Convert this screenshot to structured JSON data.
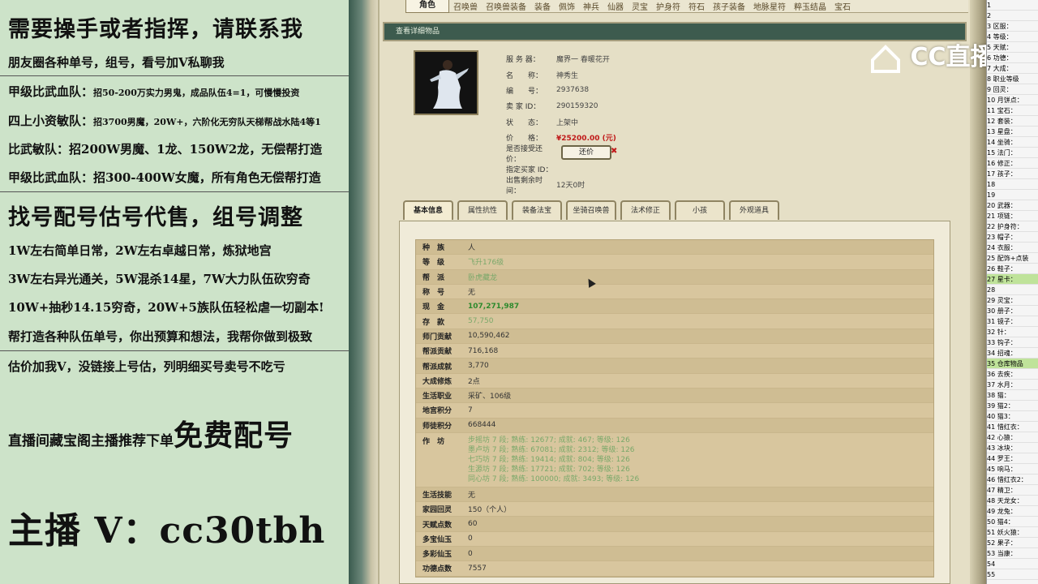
{
  "ad": {
    "l1": "需要操手或者指挥，请联系我",
    "l2": "朋友圈各种单号，组号，看号加V私聊我",
    "l3a": "甲级比武血队：",
    "l3b": "招50-200万实力男鬼，成品队伍4=1，可慢慢投资",
    "l4a": "四上小资敏队：",
    "l4b": "招3700男魔，20W+，六阶化无穷队天梯帮战水陆4等1",
    "l5": "比武敏队：招200W男魔、1龙、150W2龙，无偿帮打造",
    "l6": "甲级比武血队：招300-400W女魔，所有角色无偿帮打造",
    "l7": "找号配号估号代售，组号调整",
    "l8": "1W左右简单日常，2W左右卓越日常，炼狱地宫",
    "l9": "3W左右异光通关，5W混杀14星，7W大力队伍砍穷奇",
    "l10": "10W+抽秒14.15穷奇，20W+5族队伍轻松虐一切副本!",
    "l11": "帮打造各种队伍单号，你出预算和想法，我帮你做到极致",
    "l12": "估价加我V，没链接上号估，列明细买号卖号不吃亏",
    "l13a": "直播间藏宝阁主播推荐下单",
    "l13b": "免费配号",
    "l14": "主播 V：cc30tbh"
  },
  "nav": [
    "角色",
    "召唤兽",
    "召唤兽装备",
    "装备",
    "佩饰",
    "神兵",
    "仙器",
    "灵宝",
    "护身符",
    "符石",
    "孩子装备",
    "地脉星符",
    "粹玉结晶",
    "宝石"
  ],
  "title": "查看详细物品",
  "info": {
    "server_k": "服 务 器：",
    "server_v": "魔界一 春暖花开",
    "name_k": "名　　称：",
    "name_v": "神秀生",
    "id_k": "编　　号：",
    "id_v": "2937638",
    "seller_k": "卖 家 ID：",
    "seller_v": "290159320",
    "status_k": "状　　态：",
    "status_v": "上架中",
    "price_k": "价　　格：",
    "price_v": "¥25200.00 (元)",
    "offer_k": "是否接受还价：",
    "buyer_k": "指定买家 ID：",
    "time_k": "出售剩余时间：",
    "time_v": "12天0时"
  },
  "offer_btn": "还价",
  "subtabs": [
    "基本信息",
    "属性抗性",
    "装备法宝",
    "坐骑召唤兽",
    "法术修正",
    "小孩",
    "外观道具"
  ],
  "rows": [
    {
      "k": "种　族",
      "v": "人"
    },
    {
      "k": "等　级",
      "v": "飞升176级"
    },
    {
      "k": "帮　派",
      "v": "卧虎藏龙"
    },
    {
      "k": "称　号",
      "v": "无"
    },
    {
      "k": "现　金",
      "v": "107,271,987"
    },
    {
      "k": "存　款",
      "v": "57,750"
    },
    {
      "k": "师门贡献",
      "v": "10,590,462"
    },
    {
      "k": "帮派贡献",
      "v": "716,168"
    },
    {
      "k": "帮派成就",
      "v": "3,770"
    },
    {
      "k": "大成修炼",
      "v": "2点"
    },
    {
      "k": "生活职业",
      "v": "采矿、106级"
    },
    {
      "k": "地宫积分",
      "v": "7"
    },
    {
      "k": "师徒积分",
      "v": "668444"
    }
  ],
  "workshop_k": "作　坊",
  "workshop": [
    "步摇坊 7 段; 熟练: 12677; 成就: 467; 等级: 126",
    "墨卢坊 7 段; 熟练: 67081; 成就: 2312; 等级: 126",
    "七巧坊 7 段; 熟练: 19414; 成就: 804; 等级: 126",
    "生源坊 7 段; 熟练: 17721; 成就: 702; 等级: 126",
    "同心坊 7 段; 熟练: 100000; 成就: 3493; 等级: 126"
  ],
  "rows2": [
    {
      "k": "生活技能",
      "v": "无"
    },
    {
      "k": "家园回灵",
      "v": "150（个人）"
    },
    {
      "k": "天赋点数",
      "v": "60"
    },
    {
      "k": "多宝仙玉",
      "v": "0"
    },
    {
      "k": "多彩仙玉",
      "v": "0"
    },
    {
      "k": "功德点数",
      "v": "7557"
    }
  ],
  "logo": "CC直播",
  "sheet": [
    "1",
    "2",
    "3 区服：",
    "4 等级：",
    "5 天赋：",
    "6 功德：",
    "7 大成：",
    "8 职业等级",
    "9 回灵：",
    "10 月饼点：",
    "11 宝石：",
    "12 套装：",
    "13 星盘：",
    "14 坐骑：",
    "15 法门：",
    "16 修正：",
    "17 孩子：",
    "18",
    "19",
    "20 武器：",
    "21 项链：",
    "22 护身符：",
    "23 帽子：",
    "24 衣服：",
    "25 配饰+点装",
    "26 鞋子：",
    "27 星卡：",
    "28",
    "29 灵宝：",
    "30 册子：",
    "31 镜子：",
    "32 针：",
    "33 钩子：",
    "34 招魂：",
    "35 仓库物品",
    "36 去疾：",
    "37 水月：",
    "38 猫：",
    "39 猫2：",
    "40 猫3：",
    "41 惜红衣：",
    "42 心猿：",
    "43 冰块：",
    "44 罗王：",
    "45 响马：",
    "46 惜红衣2：",
    "47 精卫：",
    "48 天龙女：",
    "49 龙兔：",
    "50 猫4：",
    "51 妖火猿：",
    "52 果子：",
    "53 当康：",
    "54",
    "55"
  ]
}
